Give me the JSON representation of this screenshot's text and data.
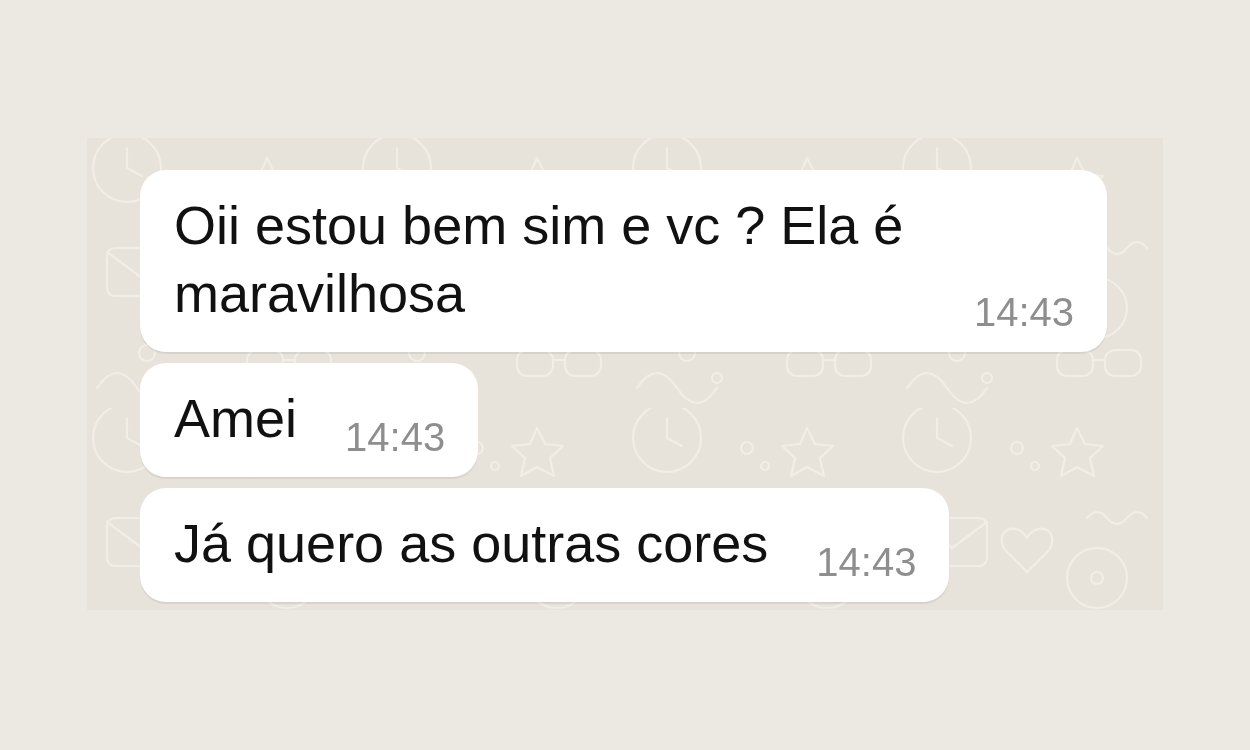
{
  "messages": [
    {
      "text": "Oii estou bem sim e vc ? Ela é maravilhosa",
      "time": "14:43"
    },
    {
      "text": "Amei",
      "time": "14:43"
    },
    {
      "text": "Já quero as outras cores",
      "time": "14:43"
    }
  ]
}
